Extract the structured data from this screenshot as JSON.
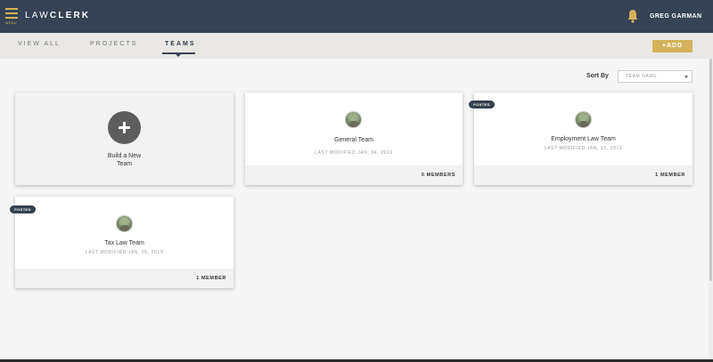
{
  "header": {
    "menu_label": "MENU",
    "brand_light": "LAW",
    "brand_bold": "CLERK",
    "user_name": "GREG GARMAN",
    "accent_color": "#d4b25a",
    "bar_color": "#354354"
  },
  "tabs": [
    {
      "label": "VIEW ALL",
      "active": false
    },
    {
      "label": "PROJECTS",
      "active": false
    },
    {
      "label": "TEAMS",
      "active": true
    }
  ],
  "add_button_label": "+ADD",
  "sort": {
    "label": "Sort By",
    "selected": "TEAM NAME"
  },
  "build_card": {
    "line1": "Build a New",
    "line2": "Team"
  },
  "teams": [
    {
      "name": "General Team",
      "modified": "LAST MODIFIED JAN, 04, 2019",
      "members": "0 MEMBERS",
      "badge": ""
    },
    {
      "name": "Employment Law Team",
      "modified": "LAST MODIFIED JAN, 10, 2019",
      "members": "1 MEMBER",
      "badge": "POSTED"
    },
    {
      "name": "Tax Law Team",
      "modified": "LAST MODIFIED JAN, 05, 2019",
      "members": "1 MEMBER",
      "badge": "POSTED"
    }
  ]
}
